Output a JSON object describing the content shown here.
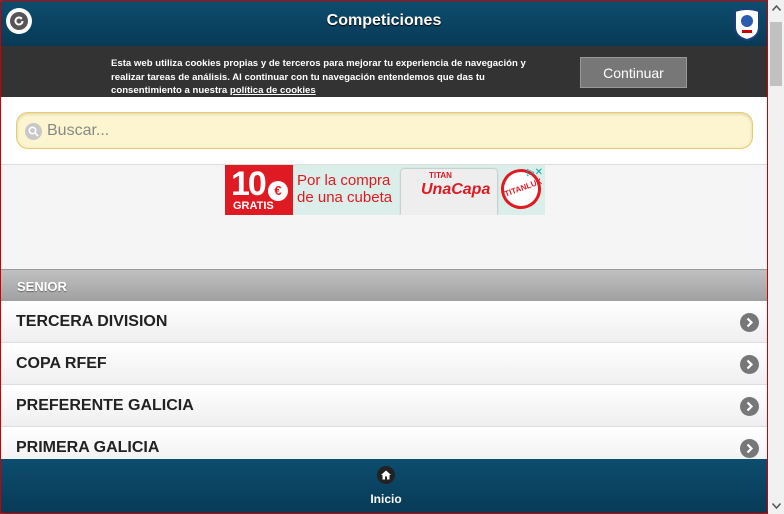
{
  "header": {
    "title": "Competiciones",
    "back_icon": "back-arrow-icon",
    "logo_icon": "rfef-crest-icon",
    "logo_text": "RFEF"
  },
  "cookie_bar": {
    "text_line1": "Esta web utiliza cookies propias y de terceros para mejorar tu experiencia de navegación y",
    "text_line2": "realizar tareas de análisis. Al continuar con tu navegación entendemos que das tu",
    "text_line3_prefix": "consentimiento a nuestra ",
    "link_text": "política de cookies",
    "button_label": "Continuar"
  },
  "search": {
    "placeholder": "Buscar...",
    "value": "",
    "icon": "search-icon"
  },
  "ad": {
    "amount": "10",
    "currency": "€",
    "gratis": "GRATIS",
    "promo_line1": "Por la compra",
    "promo_line2": "de una cubeta",
    "product_brand": "TITAN",
    "product_name": "UnaCapa",
    "brand_badge": "TITANLUX",
    "adchoices_icon": "adchoices-icon"
  },
  "list": {
    "group_label": "SENIOR",
    "items": [
      {
        "label": "TERCERA DIVISION"
      },
      {
        "label": "COPA RFEF"
      },
      {
        "label": "PREFERENTE GALICIA"
      },
      {
        "label": "PRIMERA GALICIA"
      }
    ]
  },
  "footer": {
    "home_label": "Inicio",
    "home_icon": "home-icon"
  },
  "colors": {
    "header_bg": "#0d4d6e",
    "cookie_bg": "#333333",
    "search_bg": "#fdf5cf",
    "frame_border": "#cc0000",
    "ad_red": "#e01a22"
  }
}
